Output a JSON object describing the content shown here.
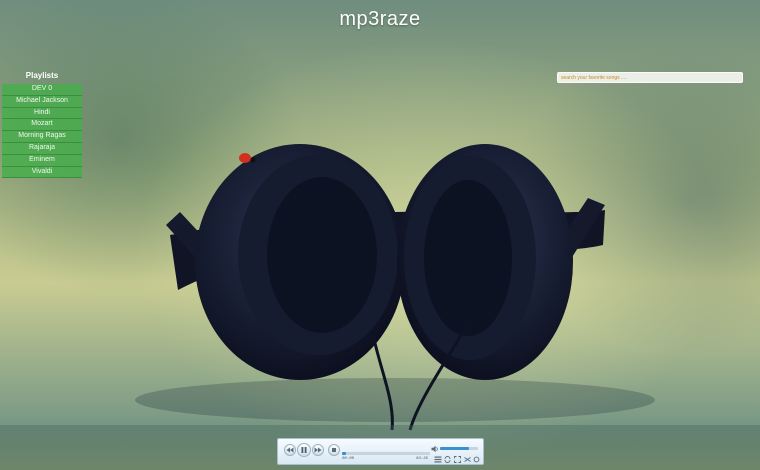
{
  "site": {
    "title": "mp3raze"
  },
  "playlists": {
    "heading": "Playlists",
    "items": [
      "DEV 0",
      "Michael Jackson",
      "Hindi",
      "Mozart",
      "Morning Ragas",
      "Rajaraja",
      "Eminem",
      "Vivaldi"
    ]
  },
  "search": {
    "placeholder": "search your favorite songs ....",
    "value": ""
  },
  "player": {
    "current_time": "00:00",
    "total_time": "03:35",
    "progress_fraction": 0.05,
    "volume_fraction": 0.75,
    "state": "paused"
  },
  "colors": {
    "playlist_bg": "#46af4b",
    "accent": "#3a8fd0",
    "title_text": "#ffffff"
  },
  "icons": {
    "rewind": "rewind-icon",
    "pause": "pause-icon",
    "forward": "fast-forward-icon",
    "stop": "stop-icon",
    "volume": "volume-icon",
    "repeat": "repeat-icon",
    "shuffle": "shuffle-icon",
    "fullscreen": "fullscreen-icon",
    "playlist": "playlist-icon"
  }
}
